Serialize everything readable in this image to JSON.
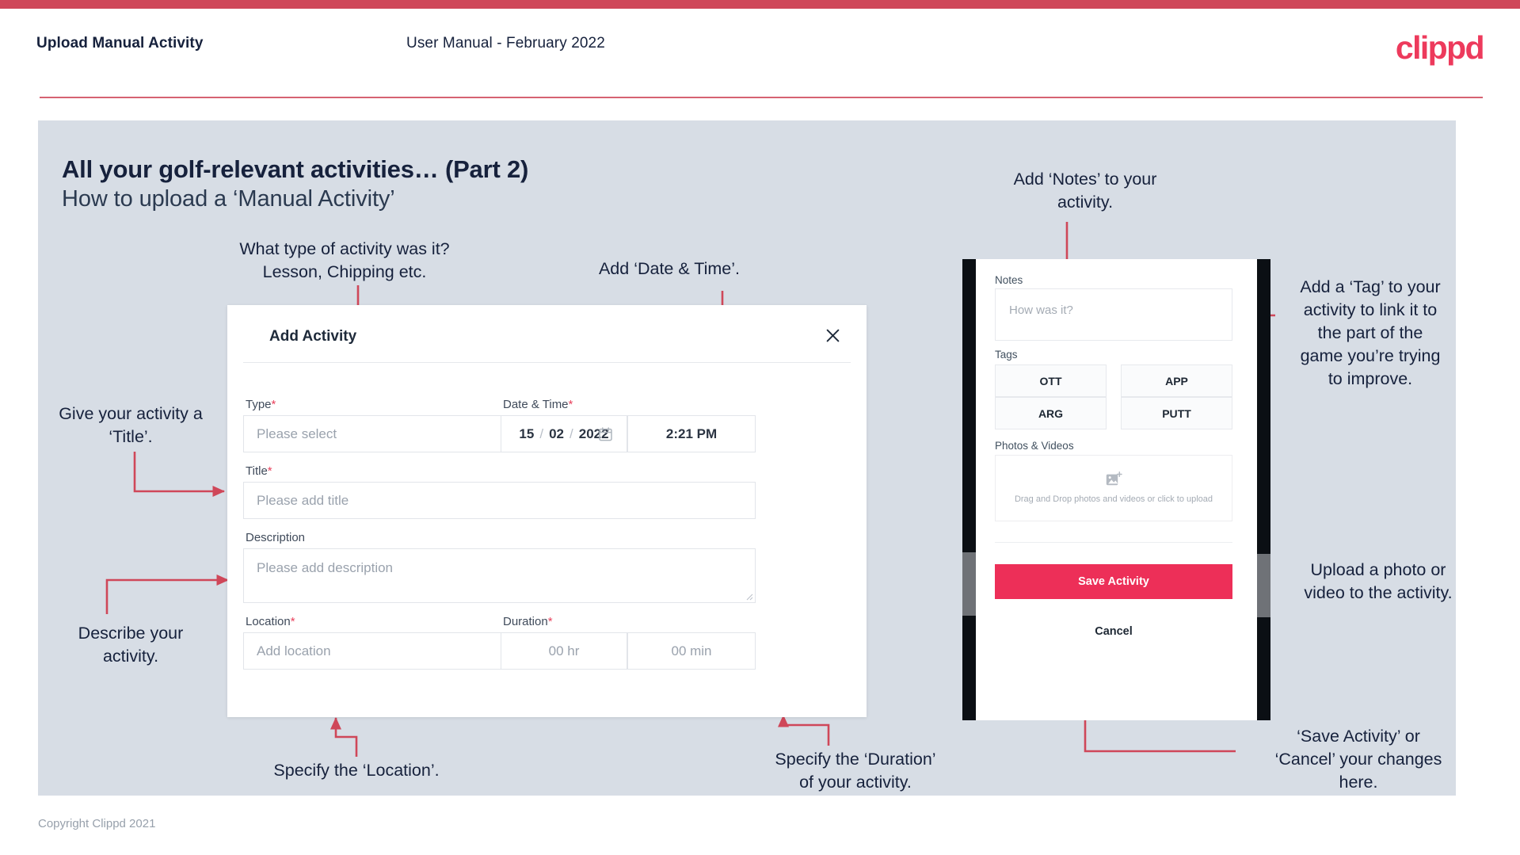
{
  "header": {
    "title": "Upload Manual Activity",
    "subtitle": "User Manual - February 2022",
    "logo": "clippd"
  },
  "slide": {
    "heading": "All your golf-relevant activities… (Part 2)",
    "subheading": "How to upload a ‘Manual Activity’"
  },
  "annotations": {
    "type": "What type of activity was it?\nLesson, Chipping etc.",
    "date_time": "Add ‘Date & Time’.",
    "title": "Give your activity a\n‘Title’.",
    "description": "Describe your\nactivity.",
    "location": "Specify the ‘Location’.",
    "duration": "Specify the ‘Duration’\nof your activity.",
    "notes": "Add ‘Notes’ to your\nactivity.",
    "tags": "Add a ‘Tag’ to your\nactivity to link it to\nthe part of the\ngame you’re trying\nto improve.",
    "upload": "Upload a photo or\nvideo to the activity.",
    "save_cancel": "‘Save Activity’ or\n‘Cancel’ your changes\nhere."
  },
  "dialog": {
    "title": "Add Activity",
    "close_icon": "close-icon",
    "fields": {
      "type": {
        "label": "Type",
        "required": "*",
        "placeholder": "Please select",
        "chevron_icon": "chevron-down-icon"
      },
      "datetime": {
        "label": "Date & Time",
        "required": "*",
        "day": "15",
        "month": "02",
        "year": "2022",
        "separator": "/",
        "calendar_icon": "calendar-icon",
        "time": "2:21 PM"
      },
      "title": {
        "label": "Title",
        "required": "*",
        "placeholder": "Please add title"
      },
      "description": {
        "label": "Description",
        "required": "",
        "placeholder": "Please add description"
      },
      "location": {
        "label": "Location",
        "required": "*",
        "placeholder": "Add location"
      },
      "duration": {
        "label": "Duration",
        "required": "*",
        "hours_placeholder": "00 hr",
        "minutes_placeholder": "00 min"
      }
    }
  },
  "phone": {
    "notes": {
      "label": "Notes",
      "placeholder": "How was it?"
    },
    "tags": {
      "label": "Tags",
      "items": [
        "OTT",
        "APP",
        "ARG",
        "PUTT"
      ]
    },
    "photos": {
      "label": "Photos & Videos",
      "icon": "add-image-icon",
      "drop_text": "Drag and Drop photos and videos or\nclick to upload"
    },
    "save_label": "Save Activity",
    "cancel_label": "Cancel"
  },
  "footer": {
    "copyright": "Copyright Clippd 2021"
  },
  "colors": {
    "brand_pink": "#ed3a5c",
    "accent_red": "#cf4759",
    "save_button": "#ed2f58",
    "slide_bg": "#d7dde5",
    "text_dark": "#16213c"
  }
}
